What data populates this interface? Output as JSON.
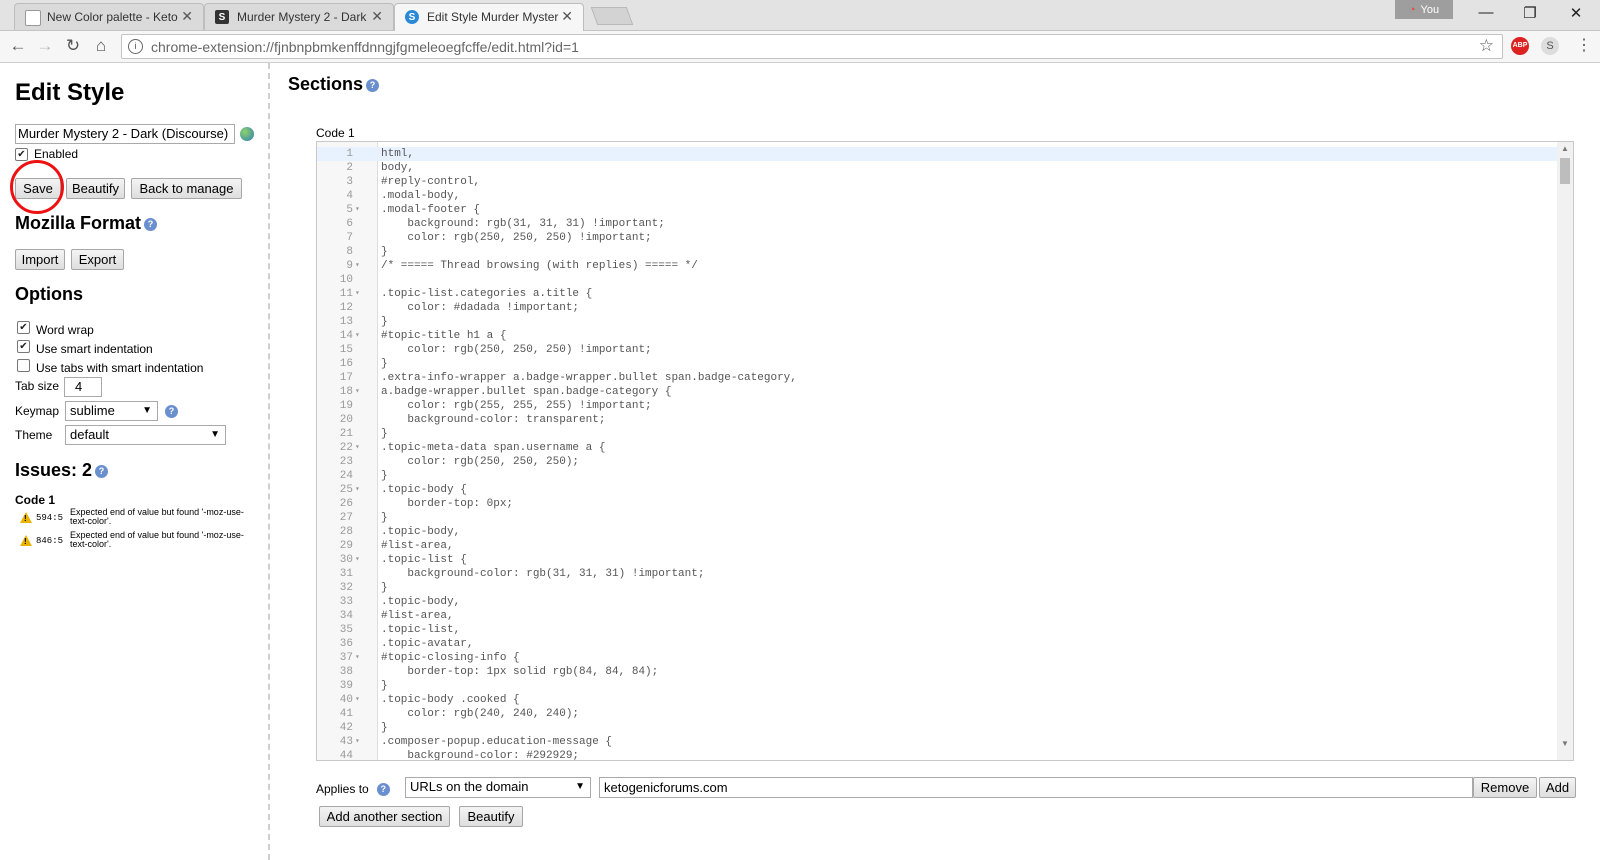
{
  "browser": {
    "tabs": [
      {
        "label": "New Color palette - Keto",
        "favicon": "page-icon",
        "active": false
      },
      {
        "label": "Murder Mystery 2 - Dark",
        "favicon": "stylish-icon",
        "active": false
      },
      {
        "label": "Edit Style Murder Myster",
        "favicon": "stylus-icon",
        "active": true
      }
    ],
    "profile_label": "You",
    "url": "chrome-extension://fjnbnpbmkenffdnngjfgmeleoegfcffe/edit.html?id=1",
    "ext_abp": "ABP",
    "ext_s": "S"
  },
  "left": {
    "title": "Edit Style",
    "style_name": "Murder Mystery 2 - Dark (Discourse)",
    "enabled_label": "Enabled",
    "save_label": "Save",
    "beautify_label": "Beautify",
    "back_label": "Back to manage",
    "mozilla_format_heading": "Mozilla Format",
    "import_label": "Import",
    "export_label": "Export",
    "options_heading": "Options",
    "word_wrap_label": "Word wrap",
    "smart_indent_label": "Use smart indentation",
    "tabs_smart_label": "Use tabs with smart indentation",
    "tab_size_label": "Tab size",
    "tab_size_value": "4",
    "keymap_label": "Keymap",
    "keymap_value": "sublime",
    "theme_label": "Theme",
    "theme_value": "default",
    "issues_heading": "Issues: 2",
    "issues_code_label": "Code 1",
    "issues": [
      {
        "pos": "594:5",
        "message": "Expected end of value but found '-moz-use-text-color'."
      },
      {
        "pos": "846:5",
        "message": "Expected end of value but found '-moz-use-text-color'."
      }
    ]
  },
  "main": {
    "sections_heading": "Sections",
    "code_label": "Code 1",
    "code_lines": [
      {
        "n": "1",
        "fold": "",
        "text": "html,"
      },
      {
        "n": "2",
        "fold": "",
        "text": "body,"
      },
      {
        "n": "3",
        "fold": "",
        "text": "#reply-control,"
      },
      {
        "n": "4",
        "fold": "",
        "text": ".modal-body,"
      },
      {
        "n": "5",
        "fold": "▾",
        "text": ".modal-footer {"
      },
      {
        "n": "6",
        "fold": "",
        "text": "    background: rgb(31, 31, 31) !important;"
      },
      {
        "n": "7",
        "fold": "",
        "text": "    color: rgb(250, 250, 250) !important;"
      },
      {
        "n": "8",
        "fold": "",
        "text": "}"
      },
      {
        "n": "9",
        "fold": "▾",
        "text": "/* ===== Thread browsing (with replies) ===== */"
      },
      {
        "n": "10",
        "fold": "",
        "text": ""
      },
      {
        "n": "11",
        "fold": "▾",
        "text": ".topic-list.categories a.title {"
      },
      {
        "n": "12",
        "fold": "",
        "text": "    color: #dadada !important;"
      },
      {
        "n": "13",
        "fold": "",
        "text": "}"
      },
      {
        "n": "14",
        "fold": "▾",
        "text": "#topic-title h1 a {"
      },
      {
        "n": "15",
        "fold": "",
        "text": "    color: rgb(250, 250, 250) !important;"
      },
      {
        "n": "16",
        "fold": "",
        "text": "}"
      },
      {
        "n": "17",
        "fold": "",
        "text": ".extra-info-wrapper a.badge-wrapper.bullet span.badge-category,"
      },
      {
        "n": "18",
        "fold": "▾",
        "text": "a.badge-wrapper.bullet span.badge-category {"
      },
      {
        "n": "19",
        "fold": "",
        "text": "    color: rgb(255, 255, 255) !important;"
      },
      {
        "n": "20",
        "fold": "",
        "text": "    background-color: transparent;"
      },
      {
        "n": "21",
        "fold": "",
        "text": "}"
      },
      {
        "n": "22",
        "fold": "▾",
        "text": ".topic-meta-data span.username a {"
      },
      {
        "n": "23",
        "fold": "",
        "text": "    color: rgb(250, 250, 250);"
      },
      {
        "n": "24",
        "fold": "",
        "text": "}"
      },
      {
        "n": "25",
        "fold": "▾",
        "text": ".topic-body {"
      },
      {
        "n": "26",
        "fold": "",
        "text": "    border-top: 0px;"
      },
      {
        "n": "27",
        "fold": "",
        "text": "}"
      },
      {
        "n": "28",
        "fold": "",
        "text": ".topic-body,"
      },
      {
        "n": "29",
        "fold": "",
        "text": "#list-area,"
      },
      {
        "n": "30",
        "fold": "▾",
        "text": ".topic-list {"
      },
      {
        "n": "31",
        "fold": "",
        "text": "    background-color: rgb(31, 31, 31) !important;"
      },
      {
        "n": "32",
        "fold": "",
        "text": "}"
      },
      {
        "n": "33",
        "fold": "",
        "text": ".topic-body,"
      },
      {
        "n": "34",
        "fold": "",
        "text": "#list-area,"
      },
      {
        "n": "35",
        "fold": "",
        "text": ".topic-list,"
      },
      {
        "n": "36",
        "fold": "",
        "text": ".topic-avatar,"
      },
      {
        "n": "37",
        "fold": "▾",
        "text": "#topic-closing-info {"
      },
      {
        "n": "38",
        "fold": "",
        "text": "    border-top: 1px solid rgb(84, 84, 84);"
      },
      {
        "n": "39",
        "fold": "",
        "text": "}"
      },
      {
        "n": "40",
        "fold": "▾",
        "text": ".topic-body .cooked {"
      },
      {
        "n": "41",
        "fold": "",
        "text": "    color: rgb(240, 240, 240);"
      },
      {
        "n": "42",
        "fold": "",
        "text": "}"
      },
      {
        "n": "43",
        "fold": "▾",
        "text": ".composer-popup.education-message {"
      },
      {
        "n": "44",
        "fold": "",
        "text": "    background-color: #292929;"
      }
    ],
    "applies_to_label": "Applies to",
    "applies_type": "URLs on the domain",
    "applies_value": "ketogenicforums.com",
    "remove_label": "Remove",
    "add_label": "Add",
    "add_section_label": "Add another section",
    "beautify_label": "Beautify"
  },
  "colors": {
    "save_highlight": "#e11111",
    "help_icon": "#6a8fce",
    "warning": "#e8b400"
  }
}
